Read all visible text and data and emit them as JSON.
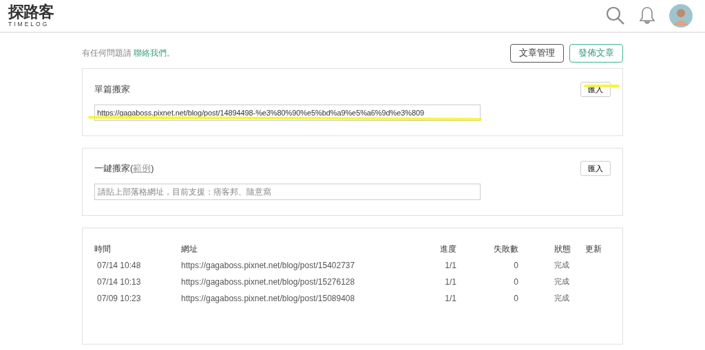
{
  "header": {
    "logo_title": "探路客",
    "logo_subtitle": "TIMELOG"
  },
  "top": {
    "help_text": "有任何問題請",
    "contact_link": "聯絡我們",
    "help_suffix": "。",
    "buttons": [
      {
        "label": "文章管理",
        "kind": "outline"
      },
      {
        "label": "發佈文章",
        "kind": "primary"
      }
    ]
  },
  "single_move": {
    "title": "單篇搬家",
    "import_button": "匯入",
    "url_value": "https://gagaboss.pixnet.net/blog/post/14894498-%e3%80%90%e5%bd%a9%e5%a6%9d%e3%809"
  },
  "bulk_move": {
    "title": "一鍵搬家(",
    "example_link": "範例",
    "title_suffix": ")",
    "import_button": "匯入",
    "placeholder": "請貼上部落格網址，目前支援：痞客邦、隨意窩"
  },
  "table": {
    "columns": [
      "時間",
      "網址",
      "進度",
      "失敗數",
      "狀態",
      "更新"
    ],
    "rows": [
      {
        "time": "07/14 10:48",
        "url": "https://gagaboss.pixnet.net/blog/post/15402737",
        "progress": "1/1",
        "failures": "0",
        "status": "完成"
      },
      {
        "time": "07/14 10:13",
        "url": "https://gagaboss.pixnet.net/blog/post/15276128",
        "progress": "1/1",
        "failures": "0",
        "status": "完成"
      },
      {
        "time": "07/09 10:23",
        "url": "https://gagaboss.pixnet.net/blog/post/15089408",
        "progress": "1/1",
        "failures": "0",
        "status": "完成"
      }
    ]
  }
}
